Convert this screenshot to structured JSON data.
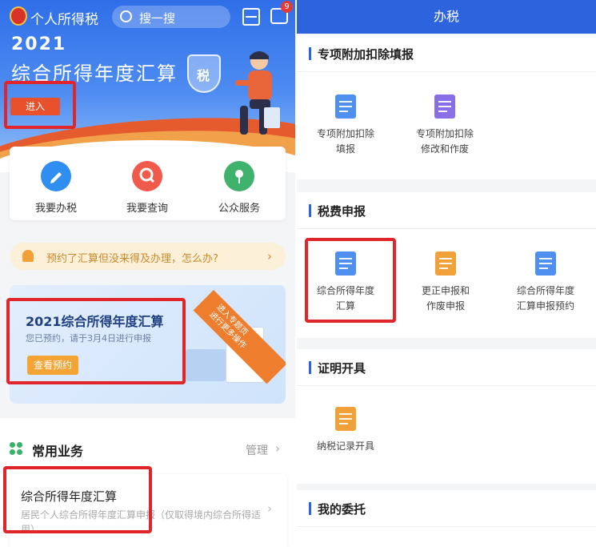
{
  "left": {
    "app_title": "个人所得税",
    "search_placeholder": "搜一搜",
    "message_badge": "9",
    "hero": {
      "year": "2021",
      "title": "综合所得年度汇算",
      "shield_text": "税",
      "enter_button": "进入"
    },
    "quick_actions": [
      {
        "label": "我要办税",
        "icon": "pencil-icon",
        "color": "#2f8ef0"
      },
      {
        "label": "我要查询",
        "icon": "search-icon",
        "color": "#ef5a4a"
      },
      {
        "label": "公众服务",
        "icon": "flower-icon",
        "color": "#3fb26d"
      }
    ],
    "notice": {
      "text": "预约了汇算但没来得及办理，怎么办?",
      "arrow": "›"
    },
    "promo": {
      "ribbon": "进入专题页\n进行更多操作",
      "title": "2021综合所得年度汇算",
      "subtitle": "您已预约，请于3月4日进行申报",
      "button": "查看预约"
    },
    "common": {
      "title": "常用业务",
      "manage": "管理",
      "arrow": "›",
      "card": {
        "title": "综合所得年度汇算",
        "subtitle": "居民个人综合所得年度汇算申报（仅取得境内综合所得适用）",
        "arrow": "›"
      }
    }
  },
  "right": {
    "header": "办税",
    "sections": [
      {
        "title": "专项附加扣除填报",
        "items": [
          {
            "label": "专项附加扣除\n填报",
            "icon": "form-edit-icon",
            "color": "#4f8ff0"
          },
          {
            "label": "专项附加扣除\n修改和作废",
            "icon": "form-settings-icon",
            "color": "#8a6ee8"
          }
        ]
      },
      {
        "title": "税费申报",
        "items": [
          {
            "label": "综合所得年度\n汇算",
            "icon": "yuan-document-icon",
            "color": "#4f8ff0"
          },
          {
            "label": "更正申报和\n作废申报",
            "icon": "document-cancel-icon",
            "color": "#f0a13a"
          },
          {
            "label": "综合所得年度\n汇算申报预约",
            "icon": "calendar-clock-icon",
            "color": "#4f8ff0"
          }
        ]
      },
      {
        "title": "证明开具",
        "items": [
          {
            "label": "纳税记录开具",
            "icon": "certificate-icon",
            "color": "#f0a13a"
          }
        ]
      },
      {
        "title": "我的委托",
        "items": []
      }
    ]
  },
  "highlight_color": "#e0262a",
  "brand_color": "#2e63de"
}
